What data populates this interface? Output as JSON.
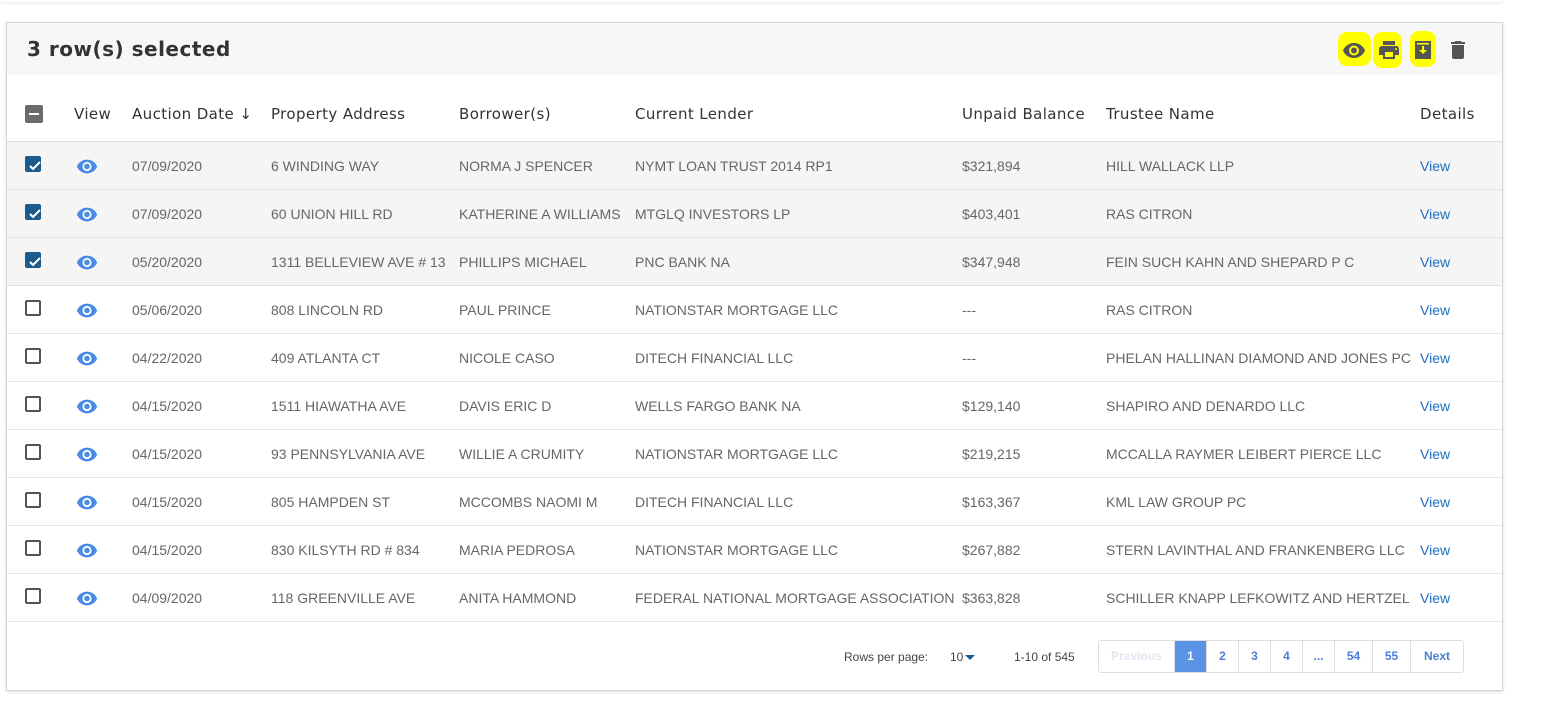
{
  "toolbar": {
    "title": "3 row(s) selected",
    "actions": [
      {
        "icon": "eye-icon",
        "highlighted": true
      },
      {
        "icon": "print-icon",
        "highlighted": true
      },
      {
        "icon": "download-icon",
        "highlighted": true
      },
      {
        "icon": "trash-icon",
        "highlighted": false
      }
    ]
  },
  "headers": {
    "view": "View",
    "auction_date": "Auction Date ↓",
    "property_address": "Property Address",
    "borrowers": "Borrower(s)",
    "current_lender": "Current Lender",
    "unpaid_balance": "Unpaid Balance",
    "trustee_name": "Trustee Name",
    "details": "Details"
  },
  "rows": [
    {
      "checked": true,
      "auction_date": "07/09/2020",
      "property_address": "6 WINDING WAY",
      "borrowers": "NORMA J SPENCER",
      "current_lender": "NYMT LOAN TRUST 2014 RP1",
      "unpaid_balance": "$321,894",
      "trustee_name": "HILL WALLACK LLP",
      "details": "View"
    },
    {
      "checked": true,
      "auction_date": "07/09/2020",
      "property_address": "60 UNION HILL RD",
      "borrowers": "KATHERINE A WILLIAMS",
      "current_lender": "MTGLQ INVESTORS LP",
      "unpaid_balance": "$403,401",
      "trustee_name": "RAS CITRON",
      "details": "View"
    },
    {
      "checked": true,
      "auction_date": "05/20/2020",
      "property_address": "1311 BELLEVIEW AVE # 13",
      "borrowers": "PHILLIPS MICHAEL",
      "current_lender": "PNC BANK NA",
      "unpaid_balance": "$347,948",
      "trustee_name": "FEIN SUCH KAHN AND SHEPARD P C",
      "details": "View"
    },
    {
      "checked": false,
      "auction_date": "05/06/2020",
      "property_address": "808 LINCOLN RD",
      "borrowers": "PAUL PRINCE",
      "current_lender": "NATIONSTAR MORTGAGE LLC",
      "unpaid_balance": "---",
      "trustee_name": "RAS CITRON",
      "details": "View"
    },
    {
      "checked": false,
      "auction_date": "04/22/2020",
      "property_address": "409 ATLANTA CT",
      "borrowers": "NICOLE CASO",
      "current_lender": "DITECH FINANCIAL LLC",
      "unpaid_balance": "---",
      "trustee_name": "PHELAN HALLINAN DIAMOND AND JONES PC",
      "details": "View"
    },
    {
      "checked": false,
      "auction_date": "04/15/2020",
      "property_address": "1511 HIAWATHA AVE",
      "borrowers": "DAVIS ERIC D",
      "current_lender": "WELLS FARGO BANK NA",
      "unpaid_balance": "$129,140",
      "trustee_name": "SHAPIRO AND DENARDO LLC",
      "details": "View"
    },
    {
      "checked": false,
      "auction_date": "04/15/2020",
      "property_address": "93 PENNSYLVANIA AVE",
      "borrowers": "WILLIE A CRUMITY",
      "current_lender": "NATIONSTAR MORTGAGE LLC",
      "unpaid_balance": "$219,215",
      "trustee_name": "MCCALLA RAYMER LEIBERT PIERCE LLC",
      "details": "View"
    },
    {
      "checked": false,
      "auction_date": "04/15/2020",
      "property_address": "805 HAMPDEN ST",
      "borrowers": "MCCOMBS NAOMI M",
      "current_lender": "DITECH FINANCIAL LLC",
      "unpaid_balance": "$163,367",
      "trustee_name": "KML LAW GROUP PC",
      "details": "View"
    },
    {
      "checked": false,
      "auction_date": "04/15/2020",
      "property_address": "830 KILSYTH RD # 834",
      "borrowers": "MARIA PEDROSA",
      "current_lender": "NATIONSTAR MORTGAGE LLC",
      "unpaid_balance": "$267,882",
      "trustee_name": "STERN LAVINTHAL AND FRANKENBERG LLC",
      "details": "View"
    },
    {
      "checked": false,
      "auction_date": "04/09/2020",
      "property_address": "118 GREENVILLE AVE",
      "borrowers": "ANITA HAMMOND",
      "current_lender": "FEDERAL NATIONAL MORTGAGE ASSOCIATION",
      "unpaid_balance": "$363,828",
      "trustee_name": "SCHILLER KNAPP LEFKOWITZ AND HERTZEL",
      "details": "View"
    }
  ],
  "footer": {
    "rows_per_page_label": "Rows per page:",
    "rows_per_page_value": "10",
    "range_text": "1-10 of 545",
    "pages": [
      {
        "label": "Previous",
        "state": "disabled"
      },
      {
        "label": "1",
        "state": "active"
      },
      {
        "label": "2",
        "state": "normal"
      },
      {
        "label": "3",
        "state": "normal"
      },
      {
        "label": "4",
        "state": "normal"
      },
      {
        "label": "...",
        "state": "normal"
      },
      {
        "label": "54",
        "state": "normal"
      },
      {
        "label": "55",
        "state": "normal"
      },
      {
        "label": "Next",
        "state": "normal"
      }
    ]
  },
  "colors": {
    "highlight": "#ffff00",
    "checkbox_checked": "#1c5b8c",
    "eye_icon": "#4a8ae8",
    "link": "#1f6fbf",
    "active_page": "#5b93e6"
  }
}
